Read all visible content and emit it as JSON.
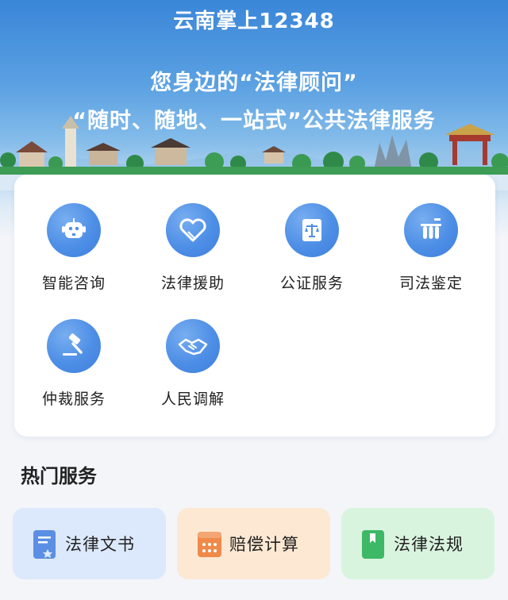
{
  "header": {
    "title": "云南掌上12348",
    "slogan_line1": "您身边的“法律顾问”",
    "slogan_line2": "“随时、随地、一站式”公共法律服务"
  },
  "services": [
    {
      "label": "智能咨询",
      "icon": "robot-icon"
    },
    {
      "label": "法律援助",
      "icon": "heart-icon"
    },
    {
      "label": "公证服务",
      "icon": "scales-document-icon"
    },
    {
      "label": "司法鉴定",
      "icon": "test-tubes-icon"
    },
    {
      "label": "仲裁服务",
      "icon": "gavel-icon"
    },
    {
      "label": "人民调解",
      "icon": "handshake-icon"
    }
  ],
  "hot_section": {
    "title": "热门服务",
    "items": [
      {
        "label": "法律文书",
        "icon": "document-icon",
        "bg": "#dce8fb",
        "accent": "#5b8fe4"
      },
      {
        "label": "赔偿计算",
        "icon": "calculator-icon",
        "bg": "#fde9d3",
        "accent": "#ef8a4a"
      },
      {
        "label": "法律法规",
        "icon": "book-icon",
        "bg": "#d9f4de",
        "accent": "#3db866"
      }
    ]
  },
  "colors": {
    "icon_blue": "#4d8ee6",
    "sky_top": "#3a86d8",
    "page_bg": "#f3f5f9"
  }
}
